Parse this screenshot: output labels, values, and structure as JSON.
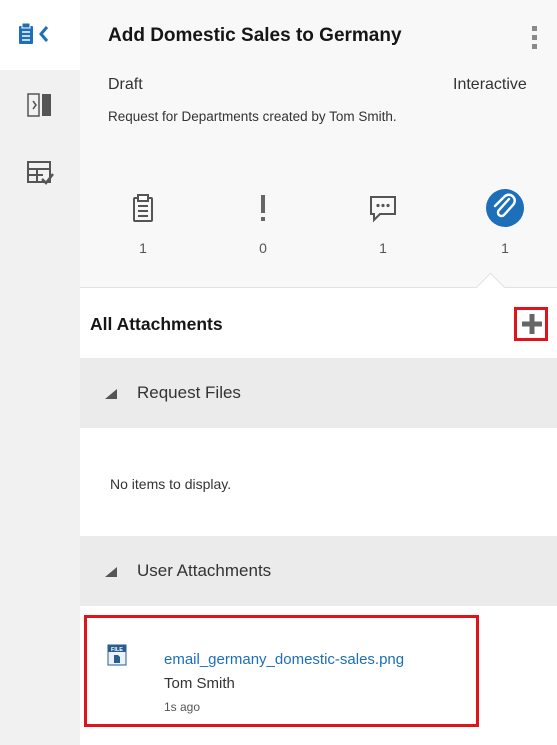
{
  "rail": {
    "icons": [
      "clipboard-collapse-icon",
      "split-panel-icon",
      "form-check-icon"
    ]
  },
  "header": {
    "title": "Add Domestic Sales to Germany",
    "status": "Draft",
    "mode": "Interactive",
    "description": "Request for Departments created by Tom Smith."
  },
  "tabs": [
    {
      "icon": "clipboard-icon",
      "count": "1"
    },
    {
      "icon": "exclamation-icon",
      "count": "0"
    },
    {
      "icon": "comment-icon",
      "count": "1"
    },
    {
      "icon": "paperclip-icon",
      "count": "1",
      "active": true
    }
  ],
  "attachments": {
    "title": "All Attachments",
    "add_icon": "plus-icon",
    "request_files": {
      "label": "Request Files",
      "empty_text": "No items to display."
    },
    "user_attachments": {
      "label": "User Attachments",
      "items": [
        {
          "icon_label": "FILE",
          "name": "email_germany_domestic-sales.png",
          "owner": "Tom Smith",
          "time": "1s ago"
        }
      ]
    }
  },
  "colors": {
    "accent": "#1c6fb8",
    "highlight": "#e0131b",
    "section_bg": "#ebebeb",
    "rail_bg": "#f1f1f1"
  }
}
